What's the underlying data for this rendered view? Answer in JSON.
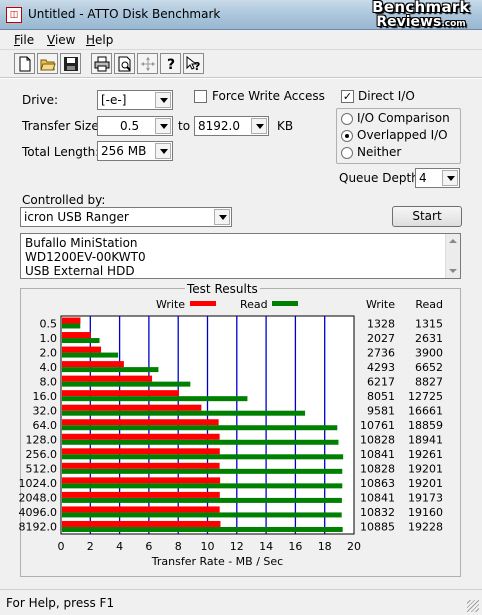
{
  "window": {
    "title": "Untitled - ATTO Disk Benchmark"
  },
  "watermark": {
    "line1": "Benchmark",
    "line2": "Reviews",
    "suffix": ".com"
  },
  "menu": {
    "items": [
      {
        "label": "File",
        "accel": "F",
        "rest": "ile"
      },
      {
        "label": "View",
        "accel": "V",
        "rest": "iew"
      },
      {
        "label": "Help",
        "accel": "H",
        "rest": "elp"
      }
    ]
  },
  "toolbar": {
    "buttons": [
      {
        "name": "new-document-icon"
      },
      {
        "name": "open-folder-icon"
      },
      {
        "name": "save-disk-icon"
      },
      {
        "name": "print-icon"
      },
      {
        "name": "print-preview-icon"
      },
      {
        "name": "move-arrows-icon"
      },
      {
        "name": "help-question-icon"
      },
      {
        "name": "context-help-icon"
      }
    ]
  },
  "form": {
    "drive_label": "Drive:",
    "drive_value": "[-e-]",
    "force_write_label": "Force Write Access",
    "force_write_checked": false,
    "direct_io_label": "Direct I/O",
    "direct_io_checked": true,
    "transfer_size_label": "Transfer Size:",
    "transfer_from": "0.5",
    "to_label": "to",
    "transfer_to": "8192.0",
    "kb_label": "KB",
    "total_length_label": "Total Length:",
    "total_length_value": "256 MB",
    "io_comparison_label": "I/O Comparison",
    "overlapped_io_label": "Overlapped I/O",
    "neither_label": "Neither",
    "queue_depth_label": "Queue Depth:",
    "queue_depth_value": "4",
    "controlled_by_label": "Controlled by:",
    "controlled_by_value": "icron USB Ranger",
    "start_label": "Start",
    "description_lines": [
      "Bufallo MiniStation",
      "WD1200EV-00KWT0",
      "USB External HDD"
    ]
  },
  "results": {
    "title": "Test Results",
    "write_col": "Write",
    "read_col": "Read"
  },
  "chart_data": {
    "type": "bar",
    "orientation": "horizontal",
    "categories": [
      "0.5",
      "1.0",
      "2.0",
      "4.0",
      "8.0",
      "16.0",
      "32.0",
      "64.0",
      "128.0",
      "256.0",
      "512.0",
      "1024.0",
      "2048.0",
      "4096.0",
      "8192.0"
    ],
    "series": [
      {
        "name": "Write",
        "color": "#ff0000",
        "values": [
          1328,
          2027,
          2736,
          4293,
          6217,
          8051,
          9581,
          10761,
          10828,
          10841,
          10828,
          10863,
          10841,
          10832,
          10885
        ]
      },
      {
        "name": "Read",
        "color": "#008000",
        "values": [
          1315,
          2631,
          3900,
          6652,
          8827,
          12725,
          16661,
          18859,
          18941,
          19261,
          19201,
          19201,
          19173,
          19160,
          19228
        ]
      }
    ],
    "xlabel": "Transfer Rate - MB / Sec",
    "xlim": [
      0,
      20
    ],
    "xticks": [
      "0",
      "2",
      "4",
      "6",
      "8",
      "10",
      "12",
      "14",
      "16",
      "18",
      "20"
    ],
    "legend": "top",
    "grid": true,
    "grid_color": "#0000cc"
  },
  "status": {
    "text": "For Help, press F1"
  }
}
